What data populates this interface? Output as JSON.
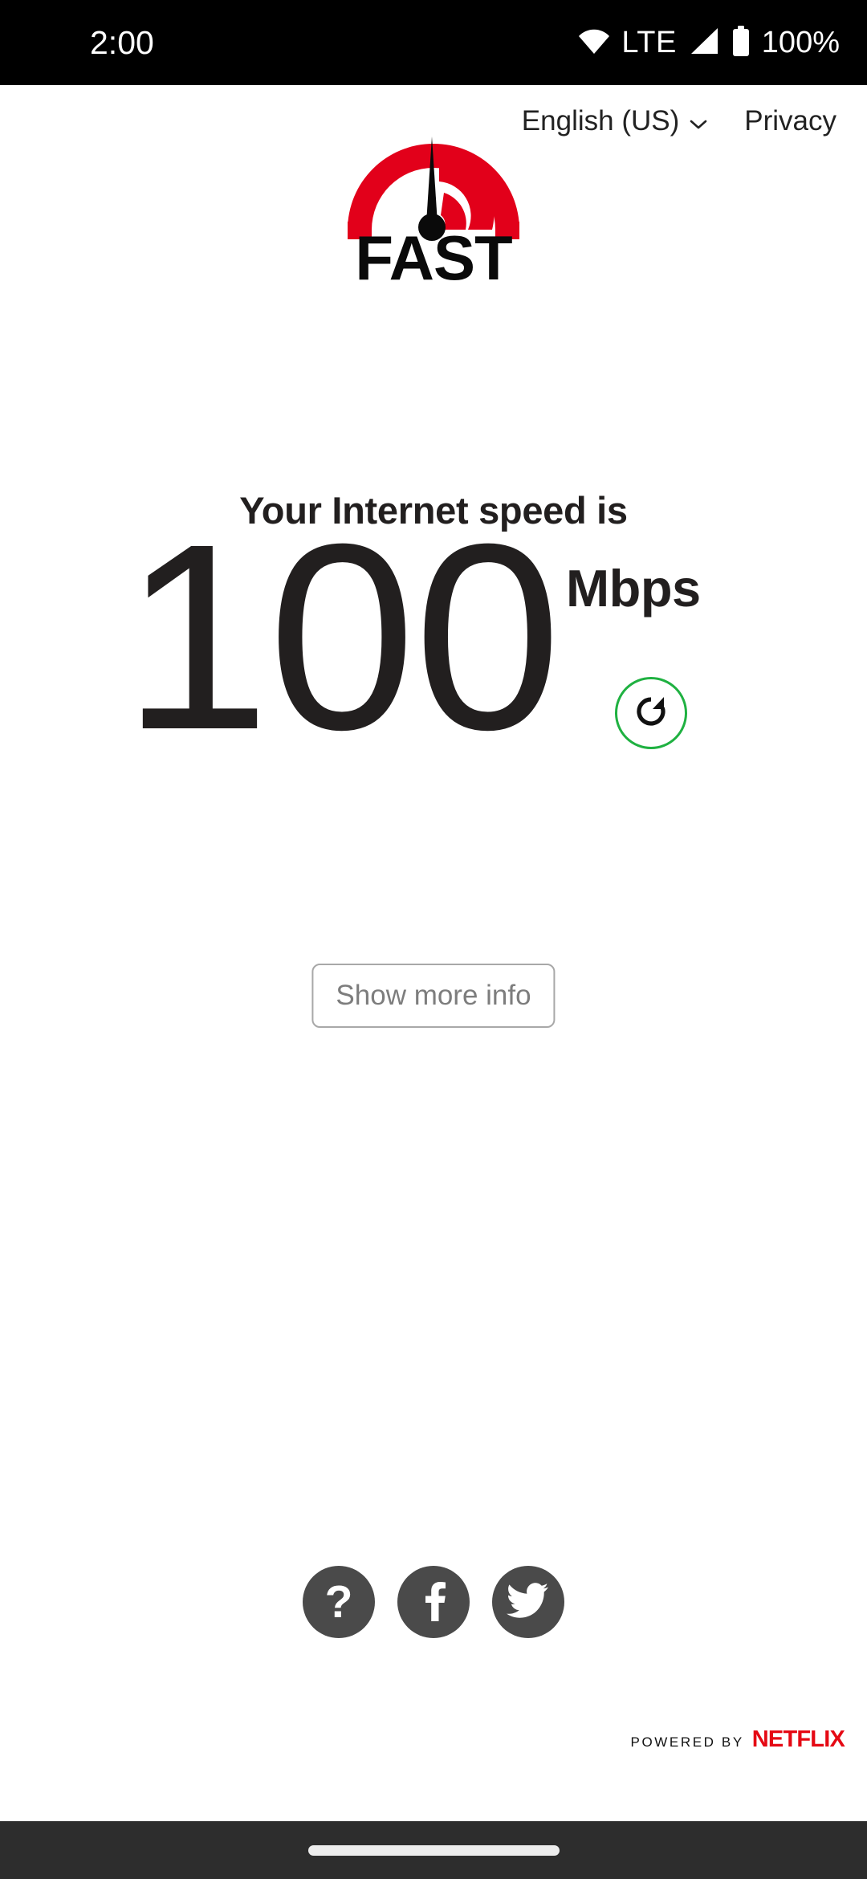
{
  "status_bar": {
    "time": "2:00",
    "network_type": "LTE",
    "battery_percent": "100%",
    "wifi_icon": "wifi-icon",
    "signal_icon": "signal-bars-icon",
    "battery_icon": "battery-full-icon",
    "background": "#000000",
    "foreground": "#ffffff"
  },
  "header": {
    "language_label": "English (US)",
    "language_chevron_icon": "chevron-down-icon",
    "privacy_label": "Privacy"
  },
  "logo": {
    "wordmark": "FAST",
    "arc_color": "#e2001a",
    "needle_color": "#000000",
    "alt": "fast-speedometer-logo"
  },
  "speed_result": {
    "caption": "Your Internet speed is",
    "value": "100",
    "units": "Mbps",
    "refresh_icon": "refresh-icon",
    "refresh_ring_color": "#1fb141",
    "text_color": "#221f1f"
  },
  "actions": {
    "show_more_label": "Show more info"
  },
  "social": {
    "help_glyph": "?",
    "help_icon": "question-mark-icon",
    "facebook_icon": "facebook-icon",
    "twitter_icon": "twitter-bird-icon",
    "circle_color": "#4a4a4a"
  },
  "footer": {
    "powered_by": "POWERED BY",
    "brand": "NETFLIX",
    "brand_color": "#e50914"
  },
  "nav_bar": {
    "gesture_pill": "home-gesture-pill",
    "background": "#2d2d2d"
  }
}
